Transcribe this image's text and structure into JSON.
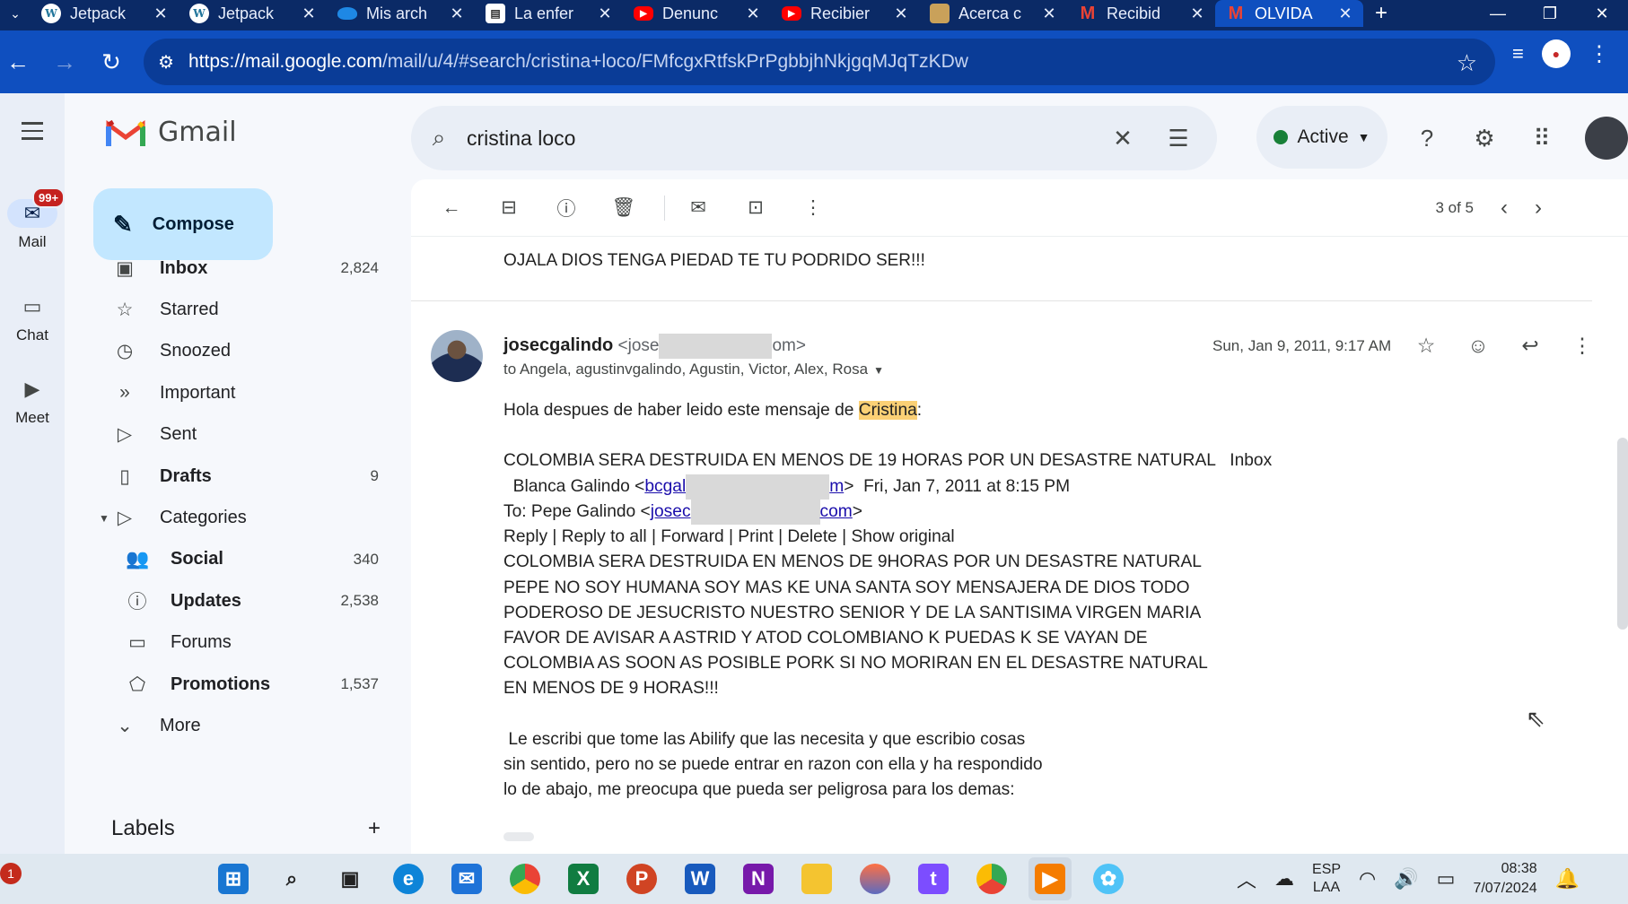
{
  "browser": {
    "tabs": [
      {
        "title": "Jetpack",
        "icon": "wordpress-icon"
      },
      {
        "title": "Jetpack",
        "icon": "wordpress-icon"
      },
      {
        "title": "Mis arch",
        "icon": "cloud-icon"
      },
      {
        "title": "La enfer",
        "icon": "document-icon"
      },
      {
        "title": "Denunc",
        "icon": "youtube-icon"
      },
      {
        "title": "Recibier",
        "icon": "youtube-icon"
      },
      {
        "title": "Acerca c",
        "icon": "image-icon"
      },
      {
        "title": "Recibid",
        "icon": "gmail-icon"
      },
      {
        "title": "OLVIDA",
        "icon": "gmail-icon"
      }
    ],
    "url_host": "https://mail.google.com",
    "url_path": "/mail/u/4/#search/cristina+loco/FMfcgxRtfskPrPgbbjhNkjgqMJqTzKDw"
  },
  "gmail": {
    "logo_text": "Gmail",
    "rail": [
      {
        "label": "Mail",
        "badge": "99+"
      },
      {
        "label": "Chat"
      },
      {
        "label": "Meet"
      }
    ],
    "compose_label": "Compose",
    "nav": [
      {
        "label": "Inbox",
        "count": "2,824"
      },
      {
        "label": "Starred",
        "count": ""
      },
      {
        "label": "Snoozed",
        "count": ""
      },
      {
        "label": "Important",
        "count": ""
      },
      {
        "label": "Sent",
        "count": ""
      },
      {
        "label": "Drafts",
        "count": "9"
      },
      {
        "label": "Categories",
        "count": ""
      },
      {
        "label": "Social",
        "count": "340"
      },
      {
        "label": "Updates",
        "count": "2,538"
      },
      {
        "label": "Forums",
        "count": ""
      },
      {
        "label": "Promotions",
        "count": "1,537"
      },
      {
        "label": "More",
        "count": ""
      }
    ],
    "labels_title": "Labels",
    "search_value": "cristina loco",
    "status": "Active",
    "pager": "3 of 5"
  },
  "message": {
    "previous_text": "OJALA DIOS TENGA PIEDAD TE TU PODRIDO SER!!!",
    "sender_name": "josecgalindo",
    "sender_email_start": "<jose",
    "sender_email_end": "om>",
    "to": "to Angela, agustinvgalindo, Agustin, Victor, Alex, Rosa",
    "date": "Sun, Jan 9, 2011, 9:17 AM",
    "body": {
      "intro_before": "Hola despues de haber leido este mensaje de ",
      "intro_highlight": "Cristina",
      "intro_after": ":",
      "subject": "COLOMBIA SERA DESTRUIDA EN MENOS DE 19 HORAS POR UN DESASTRE NATURAL   Inbox",
      "from_name": "  Blanca Galindo <",
      "from_link_a": "bcgal",
      "from_link_b": "m",
      "from_after": ">  Fri, Jan 7, 2011 at 8:15 PM",
      "to_prefix": "To: Pepe Galindo <",
      "to_link_a": "josec",
      "to_link_b": "com",
      "to_after": ">",
      "actions": "Reply | Reply to all | Forward | Print | Delete | Show original",
      "lines": [
        "COLOMBIA SERA DESTRUIDA EN MENOS DE 9HORAS POR UN DESASTRE NATURAL",
        "PEPE NO SOY HUMANA SOY MAS KE UNA SANTA SOY MENSAJERA DE DIOS TODO",
        "PODEROSO DE JESUCRISTO NUESTRO SENIOR Y DE LA SANTISIMA VIRGEN MARIA",
        "FAVOR DE AVISAR A ASTRID Y ATOD COLOMBIANO K PUEDAS K SE VAYAN DE",
        "COLOMBIA AS SOON AS POSIBLE PORK SI NO MORIRAN EN EL DESASTRE NATURAL",
        "EN MENOS DE 9 HORAS!!!"
      ],
      "closing": [
        " Le escribi que tome las Abilify que las necesita y que escribio cosas",
        "sin sentido, pero no se puede entrar en razon con ella y ha respondido",
        "lo de abajo, me preocupa que pueda ser peligrosa para los demas:"
      ]
    }
  },
  "taskbar": {
    "notification_count": "1",
    "apps": [
      "start-icon",
      "search-icon",
      "task-view-icon",
      "edge-icon",
      "mail-app-icon",
      "chrome-icon",
      "excel-icon",
      "powerpoint-icon",
      "word-icon",
      "onenote-icon",
      "file-explorer-icon",
      "browser-icon",
      "tumblr-icon",
      "chrome-alt-icon",
      "media-app-icon",
      "photos-app-icon"
    ],
    "lang_top": "ESP",
    "lang_bottom": "LAA",
    "time": "08:38",
    "date": "7/07/2024"
  }
}
